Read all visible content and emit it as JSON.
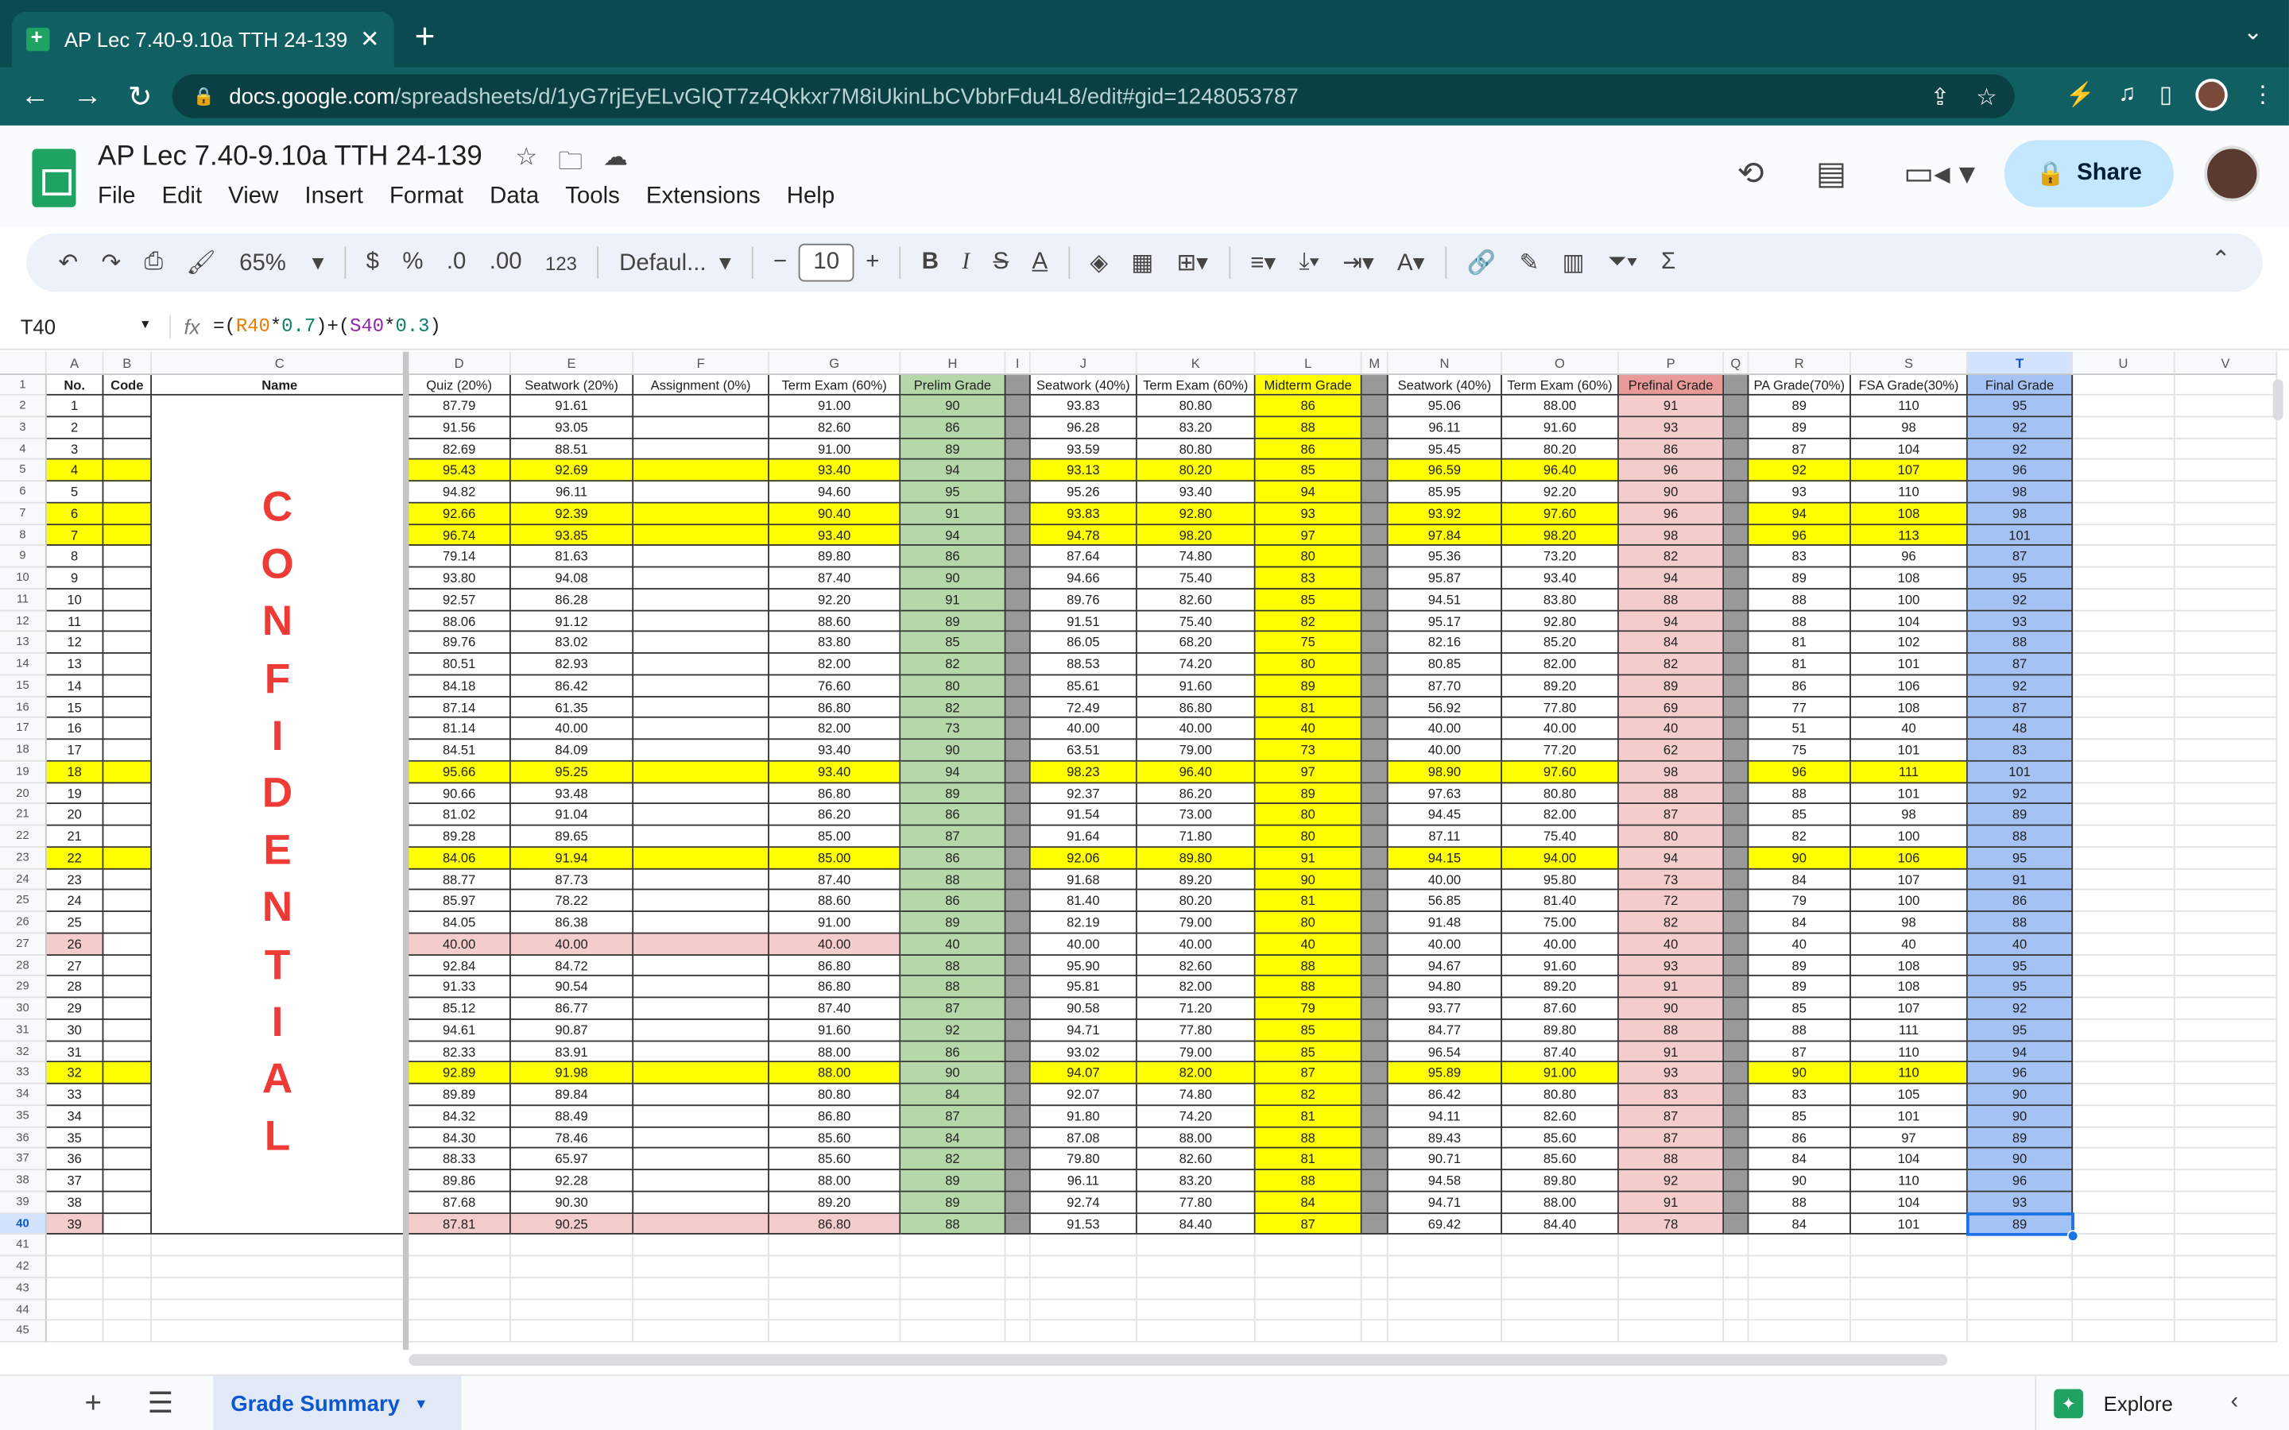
{
  "browser": {
    "tab_title": "AP Lec 7.40-9.10a TTH 24-139",
    "url_host": "docs.google.com",
    "url_path": "/spreadsheets/d/1yG7rjEyELvGlQT7z4Qkkxr7M8iUkinLbCVbbrFdu4L8/edit#gid=1248053787"
  },
  "doc": {
    "title": "AP Lec 7.40-9.10a TTH 24-139",
    "menus": [
      "File",
      "Edit",
      "View",
      "Insert",
      "Format",
      "Data",
      "Tools",
      "Extensions",
      "Help"
    ],
    "share_label": "Share"
  },
  "toolbar": {
    "zoom": "65%",
    "currency": "$",
    "percent": "%",
    "dec_less": ".0",
    "dec_more": ".00",
    "number_format": "123",
    "font": "Defaul...",
    "font_size": "10"
  },
  "formula_bar": {
    "cell_ref": "T40",
    "fx": "fx",
    "formula_parts": [
      {
        "t": "=(",
        "c": ""
      },
      {
        "t": "R40",
        "c": "f-r"
      },
      {
        "t": "*",
        "c": ""
      },
      {
        "t": "0.7",
        "c": "f-n"
      },
      {
        "t": ")+(",
        "c": ""
      },
      {
        "t": "S40",
        "c": "f-s"
      },
      {
        "t": "*",
        "c": ""
      },
      {
        "t": "0.3",
        "c": "f-n"
      },
      {
        "t": ")",
        "c": ""
      }
    ]
  },
  "colors": {
    "yellow": "#ffff00",
    "pink": "#f4cccc",
    "green": "#b6d7a8",
    "gold": "#ffff00",
    "rose": "#ea9999",
    "blue": "#a4c2f4",
    "gray": "#999999"
  },
  "columns": [
    "A",
    "B",
    "C",
    "D",
    "E",
    "F",
    "G",
    "H",
    "I",
    "J",
    "K",
    "L",
    "M",
    "N",
    "O",
    "P",
    "Q",
    "R",
    "S",
    "T",
    "U",
    "V"
  ],
  "headers": [
    "No.",
    "Code",
    "Name",
    "Quiz (20%)",
    "Seatwork (20%)",
    "Assignment (0%)",
    "Term Exam (60%)",
    "Prelim Grade",
    "",
    "Seatwork (40%)",
    "Term Exam (60%)",
    "Midterm Grade",
    "",
    "Seatwork (40%)",
    "Term Exam (60%)",
    "Prefinal Grade",
    "",
    "PA Grade(70%)",
    "FSA Grade(30%)",
    "Final Grade",
    "",
    ""
  ],
  "confidential": [
    "C",
    "O",
    "N",
    "F",
    "I",
    "D",
    "E",
    "N",
    "T",
    "I",
    "A",
    "L"
  ],
  "rows": [
    [
      "1",
      "87.79",
      "91.61",
      "91.00",
      "90",
      "93.83",
      "80.80",
      "86",
      "95.06",
      "88.00",
      "91",
      "89",
      "110",
      "95"
    ],
    [
      "2",
      "91.56",
      "93.05",
      "82.60",
      "86",
      "96.28",
      "83.20",
      "88",
      "96.11",
      "91.60",
      "93",
      "89",
      "98",
      "92"
    ],
    [
      "3",
      "82.69",
      "88.51",
      "91.00",
      "89",
      "93.59",
      "80.80",
      "86",
      "95.45",
      "80.20",
      "86",
      "87",
      "104",
      "92"
    ],
    [
      "4",
      "95.43",
      "92.69",
      "93.40",
      "94",
      "93.13",
      "80.20",
      "85",
      "96.59",
      "96.40",
      "96",
      "92",
      "107",
      "96"
    ],
    [
      "5",
      "94.82",
      "96.11",
      "94.60",
      "95",
      "95.26",
      "93.40",
      "94",
      "85.95",
      "92.20",
      "90",
      "93",
      "110",
      "98"
    ],
    [
      "6",
      "92.66",
      "92.39",
      "90.40",
      "91",
      "93.83",
      "92.80",
      "93",
      "93.92",
      "97.60",
      "96",
      "94",
      "108",
      "98"
    ],
    [
      "7",
      "96.74",
      "93.85",
      "93.40",
      "94",
      "94.78",
      "98.20",
      "97",
      "97.84",
      "98.20",
      "98",
      "96",
      "113",
      "101"
    ],
    [
      "8",
      "79.14",
      "81.63",
      "89.80",
      "86",
      "87.64",
      "74.80",
      "80",
      "95.36",
      "73.20",
      "82",
      "83",
      "96",
      "87"
    ],
    [
      "9",
      "93.80",
      "94.08",
      "87.40",
      "90",
      "94.66",
      "75.40",
      "83",
      "95.87",
      "93.40",
      "94",
      "89",
      "108",
      "95"
    ],
    [
      "10",
      "92.57",
      "86.28",
      "92.20",
      "91",
      "89.76",
      "82.60",
      "85",
      "94.51",
      "83.80",
      "88",
      "88",
      "100",
      "92"
    ],
    [
      "11",
      "88.06",
      "91.12",
      "88.60",
      "89",
      "91.51",
      "75.40",
      "82",
      "95.17",
      "92.80",
      "94",
      "88",
      "104",
      "93"
    ],
    [
      "12",
      "89.76",
      "83.02",
      "83.80",
      "85",
      "86.05",
      "68.20",
      "75",
      "82.16",
      "85.20",
      "84",
      "81",
      "102",
      "88"
    ],
    [
      "13",
      "80.51",
      "82.93",
      "82.00",
      "82",
      "88.53",
      "74.20",
      "80",
      "80.85",
      "82.00",
      "82",
      "81",
      "101",
      "87"
    ],
    [
      "14",
      "84.18",
      "86.42",
      "76.60",
      "80",
      "85.61",
      "91.60",
      "89",
      "87.70",
      "89.20",
      "89",
      "86",
      "106",
      "92"
    ],
    [
      "15",
      "87.14",
      "61.35",
      "86.80",
      "82",
      "72.49",
      "86.80",
      "81",
      "56.92",
      "77.80",
      "69",
      "77",
      "108",
      "87"
    ],
    [
      "16",
      "81.14",
      "40.00",
      "82.00",
      "73",
      "40.00",
      "40.00",
      "40",
      "40.00",
      "40.00",
      "40",
      "51",
      "40",
      "48"
    ],
    [
      "17",
      "84.51",
      "84.09",
      "93.40",
      "90",
      "63.51",
      "79.00",
      "73",
      "40.00",
      "77.20",
      "62",
      "75",
      "101",
      "83"
    ],
    [
      "18",
      "95.66",
      "95.25",
      "93.40",
      "94",
      "98.23",
      "96.40",
      "97",
      "98.90",
      "97.60",
      "98",
      "96",
      "111",
      "101"
    ],
    [
      "19",
      "90.66",
      "93.48",
      "86.80",
      "89",
      "92.37",
      "86.20",
      "89",
      "97.63",
      "80.80",
      "88",
      "88",
      "101",
      "92"
    ],
    [
      "20",
      "81.02",
      "91.04",
      "86.20",
      "86",
      "91.54",
      "73.00",
      "80",
      "94.45",
      "82.00",
      "87",
      "85",
      "98",
      "89"
    ],
    [
      "21",
      "89.28",
      "89.65",
      "85.00",
      "87",
      "91.64",
      "71.80",
      "80",
      "87.11",
      "75.40",
      "80",
      "82",
      "100",
      "88"
    ],
    [
      "22",
      "84.06",
      "91.94",
      "85.00",
      "86",
      "92.06",
      "89.80",
      "91",
      "94.15",
      "94.00",
      "94",
      "90",
      "106",
      "95"
    ],
    [
      "23",
      "88.77",
      "87.73",
      "87.40",
      "88",
      "91.68",
      "89.20",
      "90",
      "40.00",
      "95.80",
      "73",
      "84",
      "107",
      "91"
    ],
    [
      "24",
      "85.97",
      "78.22",
      "88.60",
      "86",
      "81.40",
      "80.20",
      "81",
      "56.85",
      "81.40",
      "72",
      "79",
      "100",
      "86"
    ],
    [
      "25",
      "84.05",
      "86.38",
      "91.00",
      "89",
      "82.19",
      "79.00",
      "80",
      "91.48",
      "75.00",
      "82",
      "84",
      "98",
      "88"
    ],
    [
      "26",
      "40.00",
      "40.00",
      "40.00",
      "40",
      "40.00",
      "40.00",
      "40",
      "40.00",
      "40.00",
      "40",
      "40",
      "40",
      "40"
    ],
    [
      "27",
      "92.84",
      "84.72",
      "86.80",
      "88",
      "95.90",
      "82.60",
      "88",
      "94.67",
      "91.60",
      "93",
      "89",
      "108",
      "95"
    ],
    [
      "28",
      "91.33",
      "90.54",
      "86.80",
      "88",
      "95.81",
      "82.00",
      "88",
      "94.80",
      "89.20",
      "91",
      "89",
      "108",
      "95"
    ],
    [
      "29",
      "85.12",
      "86.77",
      "87.40",
      "87",
      "90.58",
      "71.20",
      "79",
      "93.77",
      "87.60",
      "90",
      "85",
      "107",
      "92"
    ],
    [
      "30",
      "94.61",
      "90.87",
      "91.60",
      "92",
      "94.71",
      "77.80",
      "85",
      "84.77",
      "89.80",
      "88",
      "88",
      "111",
      "95"
    ],
    [
      "31",
      "82.33",
      "83.91",
      "88.00",
      "86",
      "93.02",
      "79.00",
      "85",
      "96.54",
      "87.40",
      "91",
      "87",
      "110",
      "94"
    ],
    [
      "32",
      "92.89",
      "91.98",
      "88.00",
      "90",
      "94.07",
      "82.00",
      "87",
      "95.89",
      "91.00",
      "93",
      "90",
      "110",
      "96"
    ],
    [
      "33",
      "89.89",
      "89.84",
      "80.80",
      "84",
      "92.07",
      "74.80",
      "82",
      "86.42",
      "80.80",
      "83",
      "83",
      "105",
      "90"
    ],
    [
      "34",
      "84.32",
      "88.49",
      "86.80",
      "87",
      "91.80",
      "74.20",
      "81",
      "94.11",
      "82.60",
      "87",
      "85",
      "101",
      "90"
    ],
    [
      "35",
      "84.30",
      "78.46",
      "85.60",
      "84",
      "87.08",
      "88.00",
      "88",
      "89.43",
      "85.60",
      "87",
      "86",
      "97",
      "89"
    ],
    [
      "36",
      "88.33",
      "65.97",
      "85.60",
      "82",
      "79.80",
      "82.60",
      "81",
      "90.71",
      "85.60",
      "88",
      "84",
      "104",
      "90"
    ],
    [
      "37",
      "89.86",
      "92.28",
      "88.00",
      "89",
      "96.11",
      "83.20",
      "88",
      "94.58",
      "89.80",
      "92",
      "90",
      "110",
      "96"
    ],
    [
      "38",
      "87.68",
      "90.30",
      "89.20",
      "89",
      "92.74",
      "77.80",
      "84",
      "94.71",
      "88.00",
      "91",
      "88",
      "104",
      "93"
    ],
    [
      "39",
      "87.81",
      "90.25",
      "86.80",
      "88",
      "91.53",
      "84.40",
      "87",
      "69.42",
      "84.40",
      "78",
      "84",
      "101",
      "89"
    ]
  ],
  "highlight_yellow_rows": [
    "4",
    "6",
    "7",
    "18",
    "22",
    "32"
  ],
  "highlight_pink_rows": [
    "26",
    "39"
  ],
  "row_numbers_extra": [
    "41",
    "42",
    "43",
    "44",
    "45"
  ],
  "sheet_tab": "Grade Summary",
  "explore_label": "Explore"
}
